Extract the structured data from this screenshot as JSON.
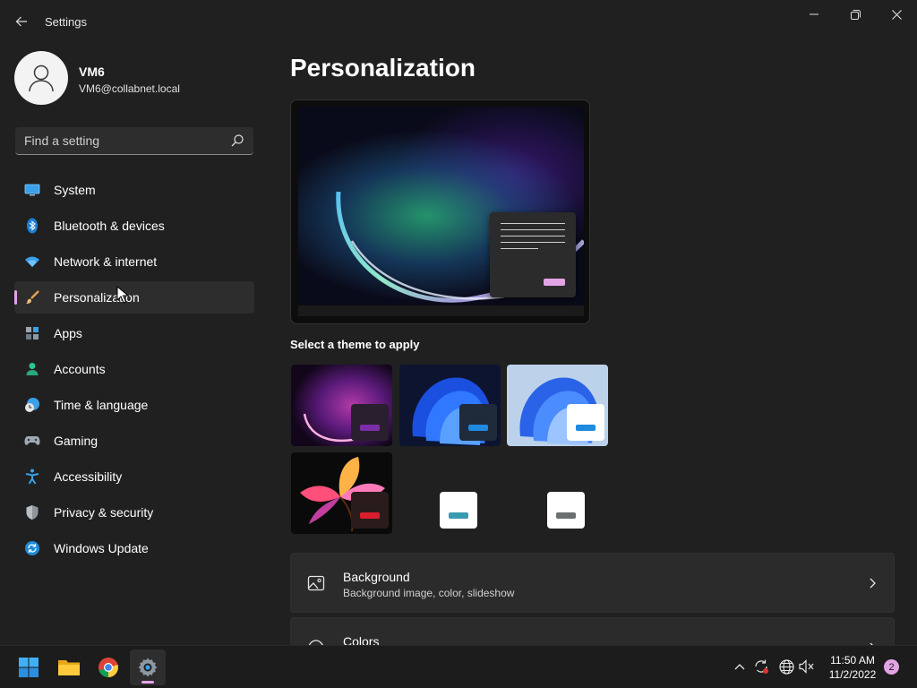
{
  "window": {
    "title": "Settings",
    "controls": [
      "minimize",
      "maximize",
      "close"
    ]
  },
  "user": {
    "name": "VM6",
    "email": "VM6@collabnet.local"
  },
  "search": {
    "placeholder": "Find a setting"
  },
  "nav": {
    "items": [
      {
        "label": "System",
        "icon": "monitor-icon"
      },
      {
        "label": "Bluetooth & devices",
        "icon": "bluetooth-icon"
      },
      {
        "label": "Network & internet",
        "icon": "wifi-icon"
      },
      {
        "label": "Personalization",
        "icon": "paintbrush-icon",
        "active": true
      },
      {
        "label": "Apps",
        "icon": "apps-icon"
      },
      {
        "label": "Accounts",
        "icon": "person-icon"
      },
      {
        "label": "Time & language",
        "icon": "clock-globe-icon"
      },
      {
        "label": "Gaming",
        "icon": "gamepad-icon"
      },
      {
        "label": "Accessibility",
        "icon": "accessibility-icon"
      },
      {
        "label": "Privacy & security",
        "icon": "shield-icon"
      },
      {
        "label": "Windows Update",
        "icon": "update-icon"
      }
    ]
  },
  "main": {
    "title": "Personalization",
    "themes_label": "Select a theme to apply",
    "cards": [
      {
        "title": "Background",
        "subtitle": "Background image, color, slideshow",
        "icon": "image-icon"
      },
      {
        "title": "Colors",
        "subtitle": "",
        "icon": "palette-icon"
      }
    ]
  },
  "colors": {
    "accent": "#e3a4e6",
    "window_bg": "#202020",
    "card_bg": "#2b2b2b",
    "taskbar_bg": "#1c1c1c"
  },
  "taskbar": {
    "apps": [
      "start-icon",
      "file-explorer-icon",
      "chrome-icon",
      "settings-icon"
    ],
    "time": "11:50 AM",
    "date": "11/2/2022",
    "notifications": "2"
  }
}
